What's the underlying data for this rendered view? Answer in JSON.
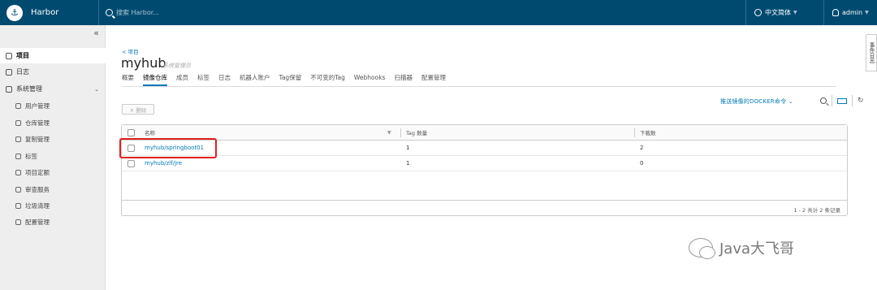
{
  "app": {
    "title": "Harbor",
    "search_placeholder": "搜索 Harbor...",
    "language": "中文简体",
    "user": "admin"
  },
  "sidebar": {
    "collapse_glyph": "«",
    "items": [
      {
        "label": "项目",
        "icon": "project-icon"
      },
      {
        "label": "日志",
        "icon": "log-icon"
      },
      {
        "label": "系统管理",
        "icon": "admin-icon"
      }
    ],
    "sub_items": [
      {
        "label": "用户管理",
        "icon": "users-icon"
      },
      {
        "label": "仓库管理",
        "icon": "registry-icon"
      },
      {
        "label": "复制管理",
        "icon": "replication-icon"
      },
      {
        "label": "标签",
        "icon": "tag-icon"
      },
      {
        "label": "项目定额",
        "icon": "quota-icon"
      },
      {
        "label": "审查服务",
        "icon": "shield-icon"
      },
      {
        "label": "垃圾清理",
        "icon": "trash-icon"
      },
      {
        "label": "配置管理",
        "icon": "gear-icon"
      }
    ]
  },
  "page": {
    "breadcrumb": "< 项目",
    "title": "myhub",
    "role": "系统管理员",
    "tabs": [
      "概要",
      "镜像仓库",
      "成员",
      "标签",
      "日志",
      "机器人账户",
      "Tag保留",
      "不可变的Tag",
      "Webhooks",
      "扫描器",
      "配置管理"
    ],
    "active_tab": "镜像仓库"
  },
  "toolbar": {
    "delete_label": "✕ 删除",
    "push_command": "推送镜像的DOCKER命令",
    "refresh_glyph": "↻"
  },
  "table": {
    "headers": [
      "名称",
      "Tag 数量",
      "下载数"
    ],
    "rows": [
      {
        "name": "myhub/springboot01",
        "tags": "1",
        "pulls": "2"
      },
      {
        "name": "myhub/zlf/jre",
        "tags": "1",
        "pulls": "0"
      }
    ],
    "footer": "1 - 2 共计 2 条记录"
  },
  "event_log": "事件日志",
  "watermark": "Java大飞哥",
  "colors": {
    "header": "#004a70",
    "accent": "#0079b8",
    "highlight": "#e02020"
  }
}
